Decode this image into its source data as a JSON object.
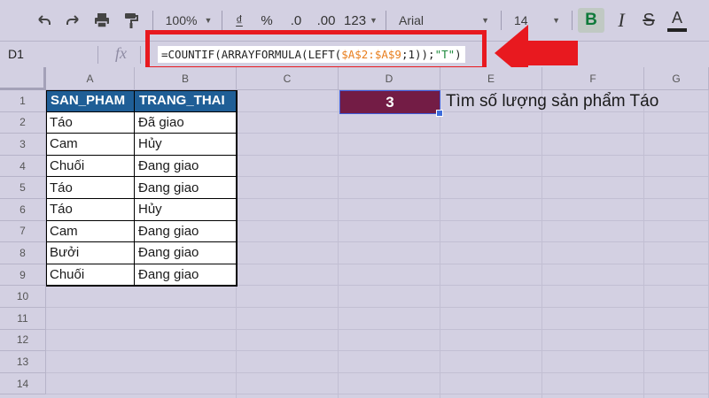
{
  "toolbar": {
    "zoom": "100%",
    "currency_symbol": "₫",
    "percent_symbol": "%",
    "decrease_decimals": ".0",
    "increase_decimals": ".00",
    "more_formats": "123",
    "font_family": "Arial",
    "font_size": "14",
    "bold": "B",
    "italic": "I",
    "strikethrough": "S",
    "text_color": "A",
    "bold_active_color": "#0f7a3a"
  },
  "formula_bar": {
    "name_box": "D1",
    "fx_label": "fx",
    "formula_parts": {
      "prefix": "=COUNTIF(ARRAYFORMULA(LEFT(",
      "range": "$A$2:$A$9",
      "mid": ";1));",
      "criteria": "\"T\"",
      "suffix": ")"
    }
  },
  "columns": [
    "A",
    "B",
    "C",
    "D",
    "E",
    "F",
    "G"
  ],
  "rows": [
    "1",
    "2",
    "3",
    "4",
    "5",
    "6",
    "7",
    "8",
    "9",
    "10",
    "11",
    "12",
    "13",
    "14"
  ],
  "table": {
    "headers": [
      "SAN_PHAM",
      "TRANG_THAI"
    ],
    "rows": [
      [
        "Táo",
        "Đã giao"
      ],
      [
        "Cam",
        "Hủy"
      ],
      [
        "Chuối",
        "Đang giao"
      ],
      [
        "Táo",
        "Đang giao"
      ],
      [
        "Táo",
        "Hủy"
      ],
      [
        "Cam",
        "Đang giao"
      ],
      [
        "Bưởi",
        "Đang giao"
      ],
      [
        "Chuối",
        "Đang giao"
      ]
    ],
    "header_color": "#1f5e96"
  },
  "result_cell": {
    "value": "3",
    "color": "#731c45"
  },
  "note": "Tìm số lượng sản phẩm Táo",
  "highlight_color": "#e8191f"
}
